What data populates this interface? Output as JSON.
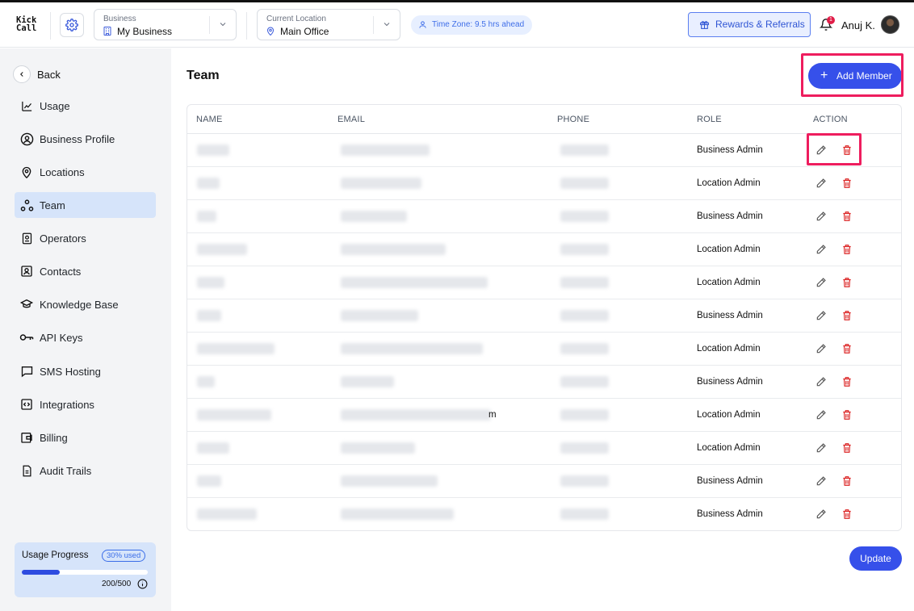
{
  "app": {
    "logo_line1": "Kick",
    "logo_line2": "Call"
  },
  "header": {
    "business": {
      "caption": "Business",
      "value": "My Business",
      "icon": "building-icon"
    },
    "location": {
      "caption": "Current Location",
      "value": "Main Office",
      "icon": "map-pin-icon"
    },
    "timezone": "Time Zone: 9.5 hrs ahead",
    "rewards_label": "Rewards & Referrals",
    "notification_count": "1",
    "user_name": "Anuj K."
  },
  "sidebar": {
    "back_label": "Back",
    "items": [
      {
        "label": "Usage",
        "icon": "chart-icon",
        "active": false
      },
      {
        "label": "Business Profile",
        "icon": "user-circle-icon",
        "active": false
      },
      {
        "label": "Locations",
        "icon": "map-pin-icon",
        "active": false
      },
      {
        "label": "Team",
        "icon": "team-icon",
        "active": true
      },
      {
        "label": "Operators",
        "icon": "operator-icon",
        "active": false
      },
      {
        "label": "Contacts",
        "icon": "contact-card-icon",
        "active": false
      },
      {
        "label": "Knowledge Base",
        "icon": "graduation-cap-icon",
        "active": false
      },
      {
        "label": "API Keys",
        "icon": "key-icon",
        "active": false
      },
      {
        "label": "SMS Hosting",
        "icon": "message-icon",
        "active": false
      },
      {
        "label": "Integrations",
        "icon": "code-box-icon",
        "active": false
      },
      {
        "label": "Billing",
        "icon": "wallet-icon",
        "active": false
      },
      {
        "label": "Audit Trails",
        "icon": "document-icon",
        "active": false
      }
    ],
    "usage": {
      "title": "Usage Progress",
      "badge": "30% used",
      "fraction": 0.3,
      "count": "200/500"
    }
  },
  "main": {
    "title": "Team",
    "add_label": "Add Member",
    "update_label": "Update",
    "columns": [
      "NAME",
      "EMAIL",
      "PHONE",
      "ROLE",
      "ACTION"
    ],
    "rows": [
      {
        "role": "Business Admin"
      },
      {
        "role": "Location Admin"
      },
      {
        "role": "Business Admin"
      },
      {
        "role": "Location Admin"
      },
      {
        "role": "Location Admin"
      },
      {
        "role": "Business Admin"
      },
      {
        "role": "Location Admin"
      },
      {
        "role": "Business Admin"
      },
      {
        "role": "Location Admin",
        "email_tail": "m"
      },
      {
        "role": "Location Admin"
      },
      {
        "role": "Business Admin"
      },
      {
        "role": "Business Admin"
      }
    ]
  },
  "colors": {
    "accent": "#3650ea",
    "highlight": "#ee1d5e",
    "delete": "#dc2626",
    "sidebar_active": "#d6e4fa"
  }
}
